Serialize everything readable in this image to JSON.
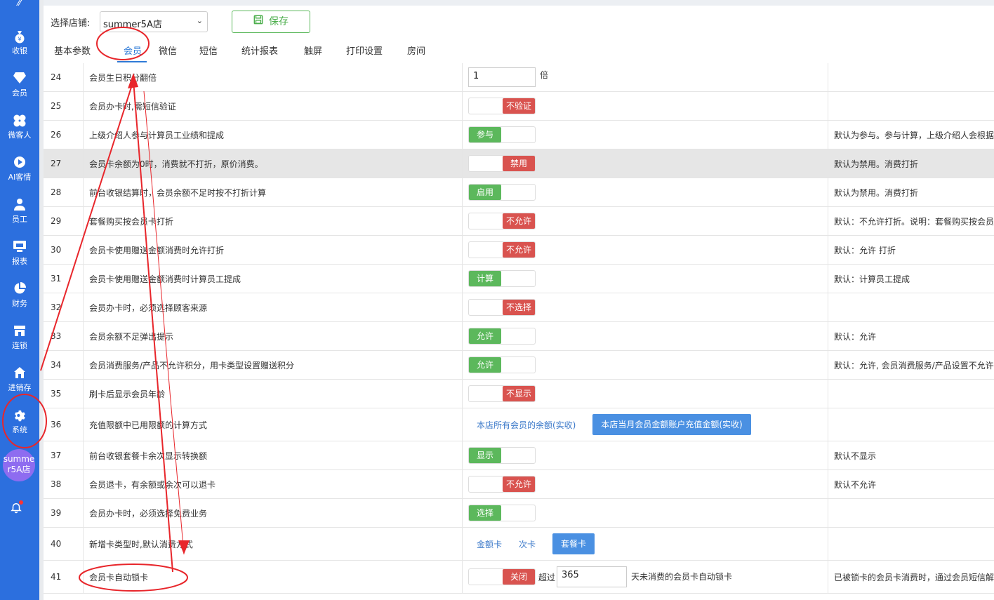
{
  "sidebar": {
    "items": [
      {
        "label": "收银",
        "icon": "money-bag-icon"
      },
      {
        "label": "会员",
        "icon": "diamond-icon"
      },
      {
        "label": "微客人",
        "icon": "clover-icon"
      },
      {
        "label": "AI客情",
        "icon": "play-circle-icon"
      },
      {
        "label": "员工",
        "icon": "user-icon"
      },
      {
        "label": "报表",
        "icon": "monitor-icon"
      },
      {
        "label": "财务",
        "icon": "pie-chart-icon"
      },
      {
        "label": "连锁",
        "icon": "store-icon"
      },
      {
        "label": "进销存",
        "icon": "house-icon"
      },
      {
        "label": "系统",
        "icon": "gear-icon"
      }
    ],
    "avatar_text": "summer5A店"
  },
  "header": {
    "store_label": "选择店铺:",
    "store_value": "summer5A店",
    "save_label": "保存",
    "tabs": [
      "基本参数",
      "会员",
      "微信",
      "短信",
      "统计报表",
      "触屏",
      "打印设置",
      "房间"
    ],
    "active_tab": "会员"
  },
  "rows": [
    {
      "num": "24",
      "name": "会员生日积分翻倍",
      "control": {
        "type": "input",
        "value": "1",
        "unit": "倍"
      },
      "desc": ""
    },
    {
      "num": "25",
      "name": "会员办卡时,需短信验证",
      "control": {
        "type": "toggle",
        "state": "off",
        "label": "不验证"
      },
      "desc": ""
    },
    {
      "num": "26",
      "name": "上级介绍人参与计算员工业绩和提成",
      "control": {
        "type": "toggle",
        "state": "on",
        "label": "参与"
      },
      "desc": "默认为参与。参与计算，上级介绍人会根据"
    },
    {
      "num": "27",
      "name": "会员卡余额为0时，消费就不打折，原价消费。",
      "control": {
        "type": "toggle",
        "state": "off",
        "label": "禁用"
      },
      "desc": "默认为禁用。消费打折"
    },
    {
      "num": "28",
      "name": "前台收银结算时，会员余额不足时按不打折计算",
      "control": {
        "type": "toggle",
        "state": "on",
        "label": "启用"
      },
      "desc": "默认为禁用。消费打折"
    },
    {
      "num": "29",
      "name": "套餐购买按会员卡打折",
      "control": {
        "type": "toggle",
        "state": "off",
        "label": "不允许"
      },
      "desc": "默认：不允许打折。说明：套餐购买按会员"
    },
    {
      "num": "30",
      "name": "会员卡使用赠送金额消费时允许打折",
      "control": {
        "type": "toggle",
        "state": "off",
        "label": "不允许"
      },
      "desc": "默认：允许 打折"
    },
    {
      "num": "31",
      "name": "会员卡使用赠送金额消费时计算员工提成",
      "control": {
        "type": "toggle",
        "state": "on",
        "label": "计算"
      },
      "desc": "默认：计算员工提成"
    },
    {
      "num": "32",
      "name": "会员办卡时，必须选择顾客来源",
      "control": {
        "type": "toggle",
        "state": "off",
        "label": "不选择"
      },
      "desc": ""
    },
    {
      "num": "33",
      "name": "会员余额不足弹出提示",
      "control": {
        "type": "toggle",
        "state": "on",
        "label": "允许"
      },
      "desc": "默认：允许"
    },
    {
      "num": "34",
      "name": "会员消费服务/产品不允许积分，用卡类型设置赠送积分",
      "control": {
        "type": "toggle",
        "state": "on",
        "label": "允许"
      },
      "desc": "默认：允许, 会员消费服务/产品设置不允许"
    },
    {
      "num": "35",
      "name": "刷卡后显示会员年龄",
      "control": {
        "type": "toggle",
        "state": "off",
        "label": "不显示"
      },
      "desc": ""
    },
    {
      "num": "36",
      "name": "充值限额中已用限额的计算方式",
      "control": {
        "type": "options",
        "options": [
          "本店所有会员的余额(实收)",
          "本店当月会员金额账户充值金额(实收)"
        ],
        "selected": 1
      },
      "desc": ""
    },
    {
      "num": "37",
      "name": "前台收银套餐卡余次显示转换额",
      "control": {
        "type": "toggle",
        "state": "on",
        "label": "显示"
      },
      "desc": "默认不显示"
    },
    {
      "num": "38",
      "name": "会员退卡，有余额或余次可以退卡",
      "control": {
        "type": "toggle",
        "state": "off",
        "label": "不允许"
      },
      "desc": "默认不允许"
    },
    {
      "num": "39",
      "name": "会员办卡时，必须选择免费业务",
      "control": {
        "type": "toggle",
        "state": "on",
        "label": "选择"
      },
      "desc": ""
    },
    {
      "num": "40",
      "name": "新增卡类型时,默认消费方式",
      "control": {
        "type": "options",
        "options": [
          "金额卡",
          "次卡",
          "套餐卡"
        ],
        "selected": 2
      },
      "desc": ""
    },
    {
      "num": "41",
      "name": "会员卡自动锁卡",
      "control": {
        "type": "lock",
        "state": "off",
        "label": "关闭",
        "prefix": "超过",
        "value": "365",
        "suffix": "天未消费的会员卡自动锁卡"
      },
      "desc": "已被锁卡的会员卡消费时，通过会员短信解"
    }
  ],
  "colors": {
    "sidebar": "#2c6fde",
    "on": "#5cb85c",
    "off": "#d9534f",
    "accent": "#2f7bd7",
    "annotation": "#e8262b"
  }
}
